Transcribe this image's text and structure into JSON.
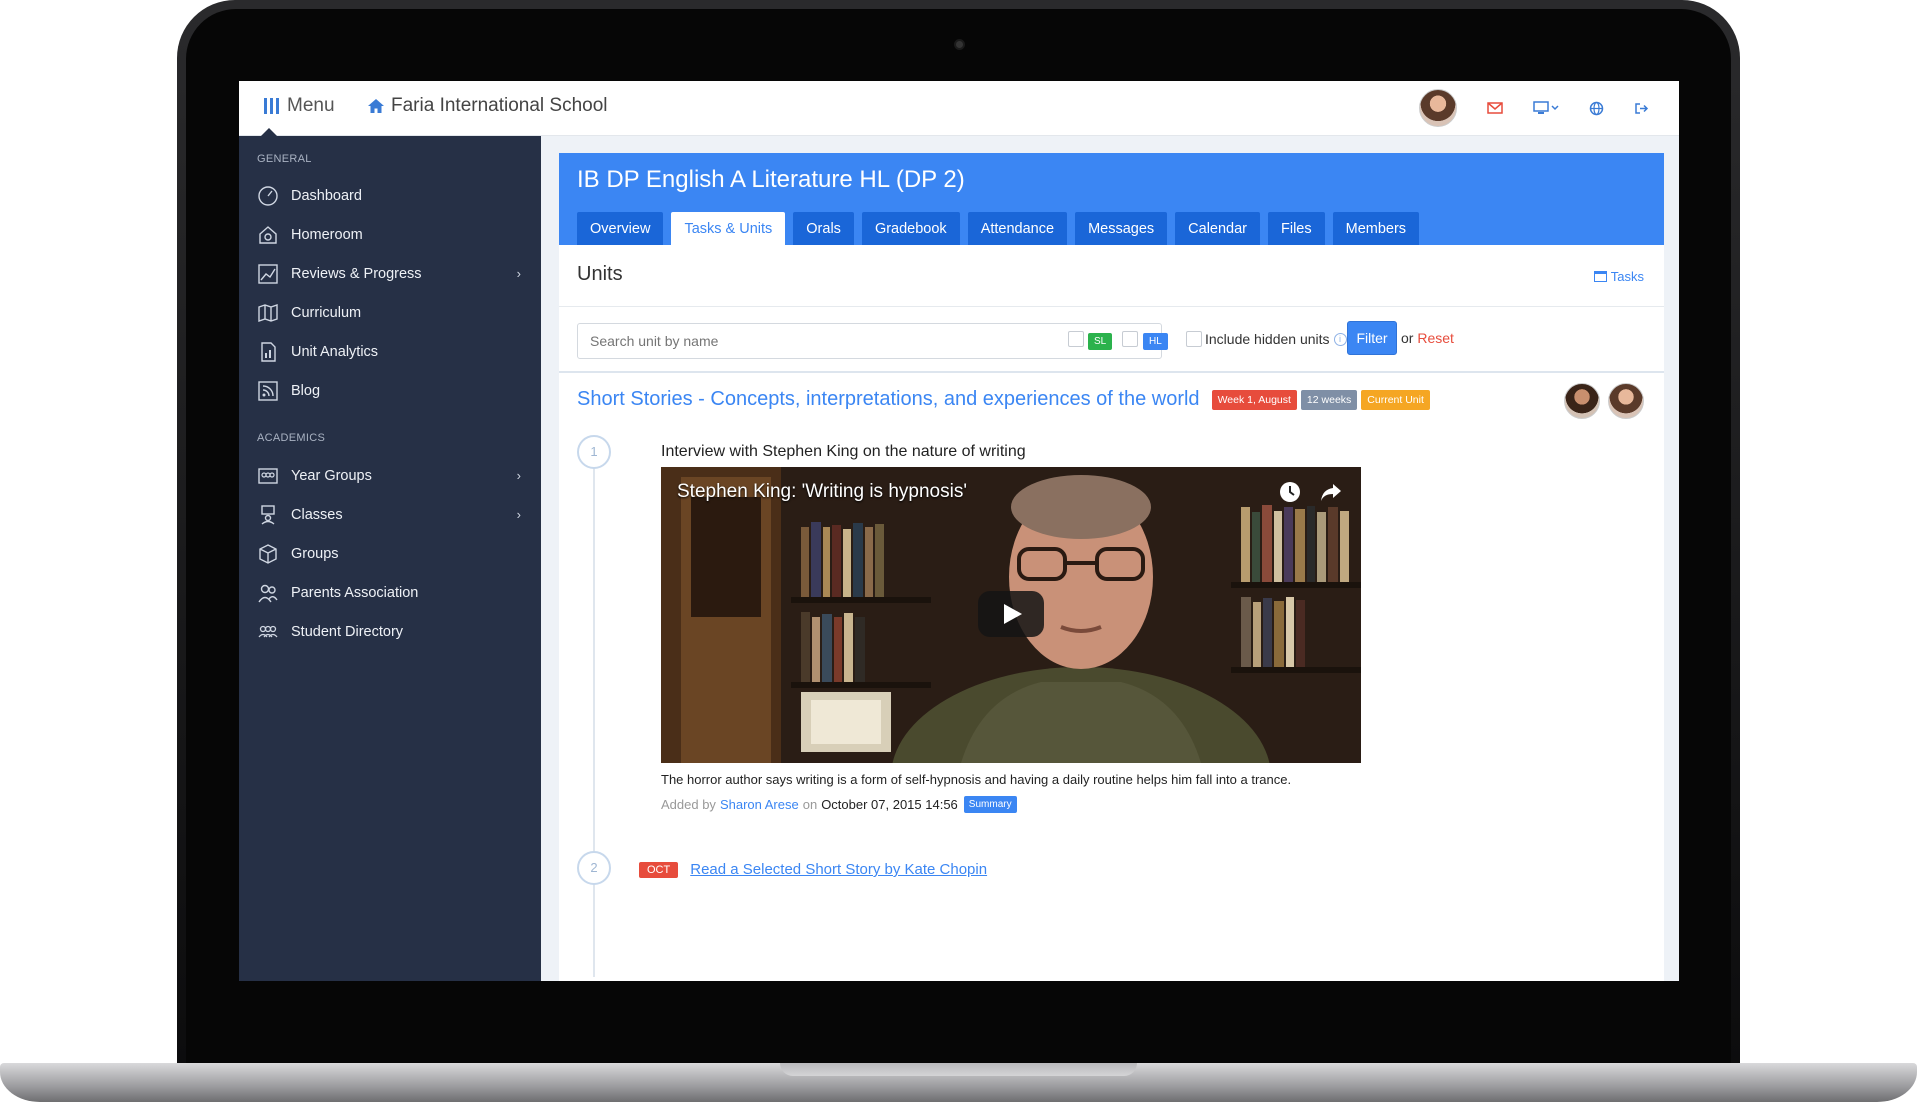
{
  "topbar": {
    "menu_label": "Menu",
    "school_name": "Faria International School",
    "accent": "#3a7bd5",
    "icons": [
      "avatar",
      "mail-icon",
      "monitor-icon",
      "globe-icon",
      "logout-icon"
    ]
  },
  "sidebar": {
    "sections": [
      {
        "label": "GENERAL",
        "items": [
          {
            "label": "Dashboard",
            "icon": "dashboard-icon"
          },
          {
            "label": "Homeroom",
            "icon": "homeroom-icon"
          },
          {
            "label": "Reviews & Progress",
            "icon": "chart-icon",
            "has_children": true
          },
          {
            "label": "Curriculum",
            "icon": "map-icon"
          },
          {
            "label": "Unit Analytics",
            "icon": "analytics-icon"
          },
          {
            "label": "Blog",
            "icon": "rss-icon"
          }
        ]
      },
      {
        "label": "ACADEMICS",
        "items": [
          {
            "label": "Year Groups",
            "icon": "year-groups-icon",
            "has_children": true
          },
          {
            "label": "Classes",
            "icon": "classes-icon",
            "has_children": true
          },
          {
            "label": "Groups",
            "icon": "cube-icon"
          },
          {
            "label": "Parents Association",
            "icon": "parents-icon"
          },
          {
            "label": "Student Directory",
            "icon": "directory-icon"
          }
        ]
      }
    ]
  },
  "course": {
    "title": "IB DP English A Literature HL (DP 2)",
    "tabs": [
      {
        "label": "Overview"
      },
      {
        "label": "Tasks & Units",
        "active": true
      },
      {
        "label": "Orals"
      },
      {
        "label": "Gradebook"
      },
      {
        "label": "Attendance"
      },
      {
        "label": "Messages"
      },
      {
        "label": "Calendar"
      },
      {
        "label": "Files"
      },
      {
        "label": "Members"
      }
    ]
  },
  "units": {
    "title": "Units",
    "tasks_link": "Tasks",
    "search_placeholder": "Search unit by name",
    "badge_sl": "SL",
    "badge_hl": "HL",
    "include_hidden": "Include hidden units",
    "info_glyph": "i",
    "filter_label": "Filter",
    "or_label": "or",
    "reset_label": "Reset"
  },
  "unit": {
    "title": "Short Stories - Concepts, interpretations, and experiences of the world",
    "pills": [
      {
        "text": "Week 1, August",
        "color": "#e74c3c"
      },
      {
        "text": "12 weeks",
        "color": "#7f8fa6"
      },
      {
        "text": "Current Unit",
        "color": "#f5a623"
      }
    ],
    "items": [
      {
        "step": "1",
        "title": "Interview with Stephen King on the nature of writing",
        "video_title": "Stephen King: 'Writing is hypnosis'",
        "caption": "The horror author says writing is a form of self-hypnosis and having a daily routine helps him fall into a trance.",
        "added_by_label": "Added by",
        "author": "Sharon Arese",
        "on_label": "on",
        "date": "October 07, 2015 14:56",
        "tag": "Summary"
      },
      {
        "step": "2",
        "month": "OCT",
        "title": "Read a Selected Short Story by Kate Chopin"
      }
    ]
  }
}
